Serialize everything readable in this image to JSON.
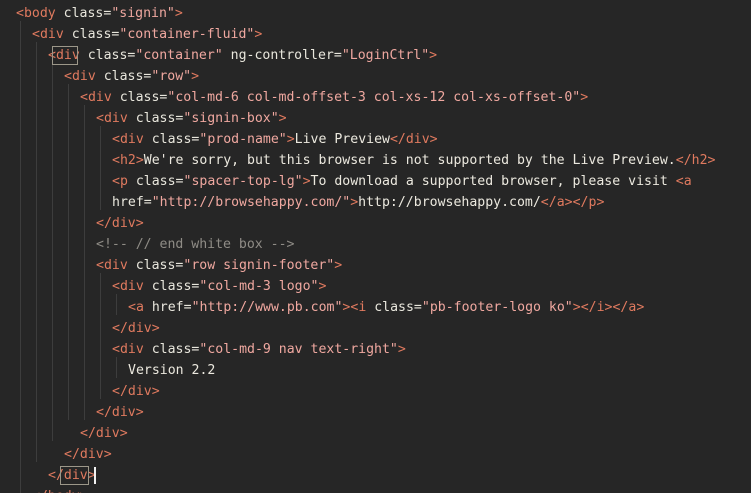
{
  "editor": {
    "lines": [
      {
        "segments": [
          {
            "t": "<",
            "c": "tag"
          },
          {
            "t": "body",
            "c": "tag"
          },
          {
            "t": " class",
            "c": "attr"
          },
          {
            "t": "=",
            "c": "attr"
          },
          {
            "t": "\"signin\"",
            "c": "str"
          },
          {
            "t": ">",
            "c": "tag"
          }
        ]
      },
      {
        "segments": [
          {
            "t": "<",
            "c": "tag"
          },
          {
            "t": "div",
            "c": "tag"
          },
          {
            "t": " class",
            "c": "attr"
          },
          {
            "t": "=",
            "c": "attr"
          },
          {
            "t": "\"container-fluid\"",
            "c": "str"
          },
          {
            "t": ">",
            "c": "tag"
          }
        ]
      },
      {
        "segments": [
          {
            "t": "<",
            "c": "tag"
          },
          {
            "t": "div",
            "c": "tag"
          },
          {
            "t": " class",
            "c": "attr"
          },
          {
            "t": "=",
            "c": "attr"
          },
          {
            "t": "\"container\"",
            "c": "str"
          },
          {
            "t": " ng-controller",
            "c": "attr"
          },
          {
            "t": "=",
            "c": "attr"
          },
          {
            "t": "\"LoginCtrl\"",
            "c": "str"
          },
          {
            "t": ">",
            "c": "tag"
          }
        ]
      },
      {
        "segments": [
          {
            "t": "<",
            "c": "tag"
          },
          {
            "t": "div",
            "c": "tag"
          },
          {
            "t": " class",
            "c": "attr"
          },
          {
            "t": "=",
            "c": "attr"
          },
          {
            "t": "\"row\"",
            "c": "str"
          },
          {
            "t": ">",
            "c": "tag"
          }
        ]
      },
      {
        "segments": [
          {
            "t": "<",
            "c": "tag"
          },
          {
            "t": "div",
            "c": "tag"
          },
          {
            "t": " class",
            "c": "attr"
          },
          {
            "t": "=",
            "c": "attr"
          },
          {
            "t": "\"col-md-6 col-md-offset-3 col-xs-12 col-xs-offset-0\"",
            "c": "str"
          },
          {
            "t": ">",
            "c": "tag"
          }
        ]
      },
      {
        "segments": [
          {
            "t": "<",
            "c": "tag"
          },
          {
            "t": "div",
            "c": "tag"
          },
          {
            "t": " class",
            "c": "attr"
          },
          {
            "t": "=",
            "c": "attr"
          },
          {
            "t": "\"signin-box\"",
            "c": "str"
          },
          {
            "t": ">",
            "c": "tag"
          }
        ]
      },
      {
        "segments": [
          {
            "t": "<",
            "c": "tag"
          },
          {
            "t": "div",
            "c": "tag"
          },
          {
            "t": " class",
            "c": "attr"
          },
          {
            "t": "=",
            "c": "attr"
          },
          {
            "t": "\"prod-name\"",
            "c": "str"
          },
          {
            "t": ">",
            "c": "tag"
          },
          {
            "t": "Live Preview",
            "c": "txt"
          },
          {
            "t": "</",
            "c": "tag"
          },
          {
            "t": "div",
            "c": "tag"
          },
          {
            "t": ">",
            "c": "tag"
          }
        ]
      },
      {
        "segments": [
          {
            "t": "<",
            "c": "tag"
          },
          {
            "t": "h2",
            "c": "tag"
          },
          {
            "t": ">",
            "c": "tag"
          },
          {
            "t": "We're sorry, but this browser is not supported by the Live Preview.",
            "c": "txt"
          },
          {
            "t": "</",
            "c": "tag"
          },
          {
            "t": "h2",
            "c": "tag"
          },
          {
            "t": ">",
            "c": "tag"
          }
        ]
      },
      {
        "segments": [
          {
            "t": "<",
            "c": "tag"
          },
          {
            "t": "p",
            "c": "tag"
          },
          {
            "t": " class",
            "c": "attr"
          },
          {
            "t": "=",
            "c": "attr"
          },
          {
            "t": "\"spacer-top-lg\"",
            "c": "str"
          },
          {
            "t": ">",
            "c": "tag"
          },
          {
            "t": "To download a supported browser, please visit ",
            "c": "txt"
          },
          {
            "t": "<",
            "c": "tag"
          },
          {
            "t": "a",
            "c": "tag"
          }
        ]
      },
      {
        "segments": [
          {
            "t": "href",
            "c": "attr"
          },
          {
            "t": "=",
            "c": "attr"
          },
          {
            "t": "\"http://browsehappy.com/\"",
            "c": "str"
          },
          {
            "t": ">",
            "c": "tag"
          },
          {
            "t": "http://browsehappy.com/",
            "c": "txt"
          },
          {
            "t": "</",
            "c": "tag"
          },
          {
            "t": "a",
            "c": "tag"
          },
          {
            "t": ">",
            "c": "tag"
          },
          {
            "t": "</",
            "c": "tag"
          },
          {
            "t": "p",
            "c": "tag"
          },
          {
            "t": ">",
            "c": "tag"
          }
        ]
      },
      {
        "segments": [
          {
            "t": "</",
            "c": "tag"
          },
          {
            "t": "div",
            "c": "tag"
          },
          {
            "t": ">",
            "c": "tag"
          }
        ]
      },
      {
        "segments": [
          {
            "t": "<!-- // end white box -->",
            "c": "cmt"
          }
        ]
      },
      {
        "segments": [
          {
            "t": "<",
            "c": "tag"
          },
          {
            "t": "div",
            "c": "tag"
          },
          {
            "t": " class",
            "c": "attr"
          },
          {
            "t": "=",
            "c": "attr"
          },
          {
            "t": "\"row signin-footer\"",
            "c": "str"
          },
          {
            "t": ">",
            "c": "tag"
          }
        ]
      },
      {
        "segments": [
          {
            "t": "<",
            "c": "tag"
          },
          {
            "t": "div",
            "c": "tag"
          },
          {
            "t": " class",
            "c": "attr"
          },
          {
            "t": "=",
            "c": "attr"
          },
          {
            "t": "\"col-md-3 logo\"",
            "c": "str"
          },
          {
            "t": ">",
            "c": "tag"
          }
        ]
      },
      {
        "segments": [
          {
            "t": "<",
            "c": "tag"
          },
          {
            "t": "a",
            "c": "tag"
          },
          {
            "t": " href",
            "c": "attr"
          },
          {
            "t": "=",
            "c": "attr"
          },
          {
            "t": "\"http://www.pb.com\"",
            "c": "str"
          },
          {
            "t": ">",
            "c": "tag"
          },
          {
            "t": "<",
            "c": "tag"
          },
          {
            "t": "i",
            "c": "tag"
          },
          {
            "t": " class",
            "c": "attr"
          },
          {
            "t": "=",
            "c": "attr"
          },
          {
            "t": "\"pb-footer-logo ko\"",
            "c": "str"
          },
          {
            "t": ">",
            "c": "tag"
          },
          {
            "t": "</",
            "c": "tag"
          },
          {
            "t": "i",
            "c": "tag"
          },
          {
            "t": ">",
            "c": "tag"
          },
          {
            "t": "</",
            "c": "tag"
          },
          {
            "t": "a",
            "c": "tag"
          },
          {
            "t": ">",
            "c": "tag"
          }
        ]
      },
      {
        "segments": [
          {
            "t": "</",
            "c": "tag"
          },
          {
            "t": "div",
            "c": "tag"
          },
          {
            "t": ">",
            "c": "tag"
          }
        ]
      },
      {
        "segments": [
          {
            "t": "<",
            "c": "tag"
          },
          {
            "t": "div",
            "c": "tag"
          },
          {
            "t": " class",
            "c": "attr"
          },
          {
            "t": "=",
            "c": "attr"
          },
          {
            "t": "\"col-md-9 nav text-right\"",
            "c": "str"
          },
          {
            "t": ">",
            "c": "tag"
          }
        ]
      },
      {
        "segments": [
          {
            "t": "Version 2.2",
            "c": "txt"
          }
        ]
      },
      {
        "segments": [
          {
            "t": "</",
            "c": "tag"
          },
          {
            "t": "div",
            "c": "tag"
          },
          {
            "t": ">",
            "c": "tag"
          }
        ]
      },
      {
        "segments": [
          {
            "t": "</",
            "c": "tag"
          },
          {
            "t": "div",
            "c": "tag"
          },
          {
            "t": ">",
            "c": "tag"
          }
        ]
      },
      {
        "segments": [
          {
            "t": "</",
            "c": "tag"
          },
          {
            "t": "div",
            "c": "tag"
          },
          {
            "t": ">",
            "c": "tag"
          }
        ]
      },
      {
        "segments": [
          {
            "t": "</",
            "c": "tag"
          },
          {
            "t": "div",
            "c": "tag"
          },
          {
            "t": ">",
            "c": "tag"
          }
        ]
      },
      {
        "segments": [
          {
            "t": "</",
            "c": "tag"
          },
          {
            "t": "div",
            "c": "tag"
          },
          {
            "t": ">",
            "c": "tag"
          }
        ]
      },
      {
        "segments": [
          {
            "t": "</",
            "c": "tag"
          },
          {
            "t": "body",
            "c": "tag"
          },
          {
            "t": ">",
            "c": "tag"
          }
        ]
      }
    ]
  },
  "colors": {
    "background": "#262626",
    "tag": "#e07a5f",
    "string": "#f0a8a0",
    "text": "#ece9df",
    "comment": "#8f8c86"
  }
}
